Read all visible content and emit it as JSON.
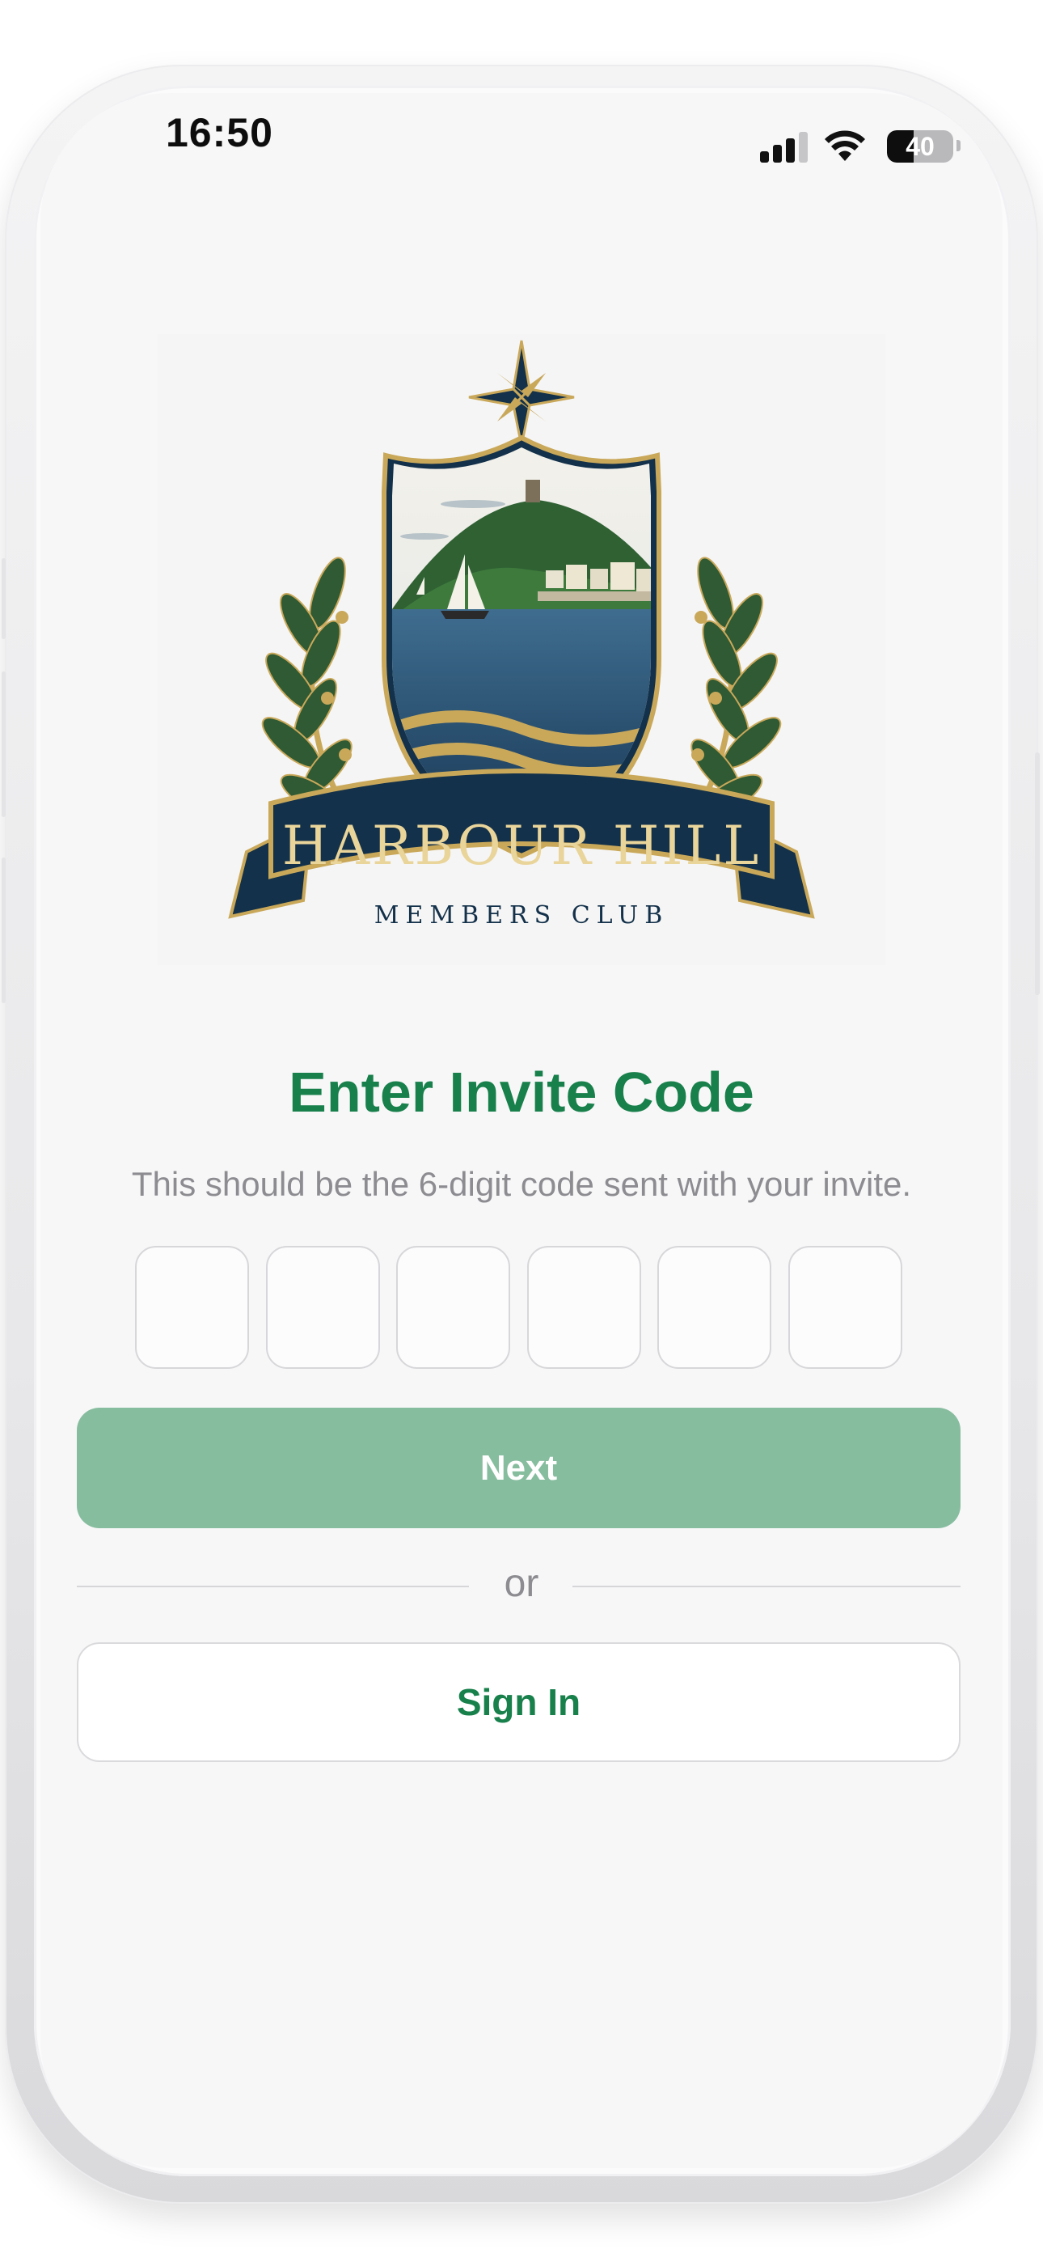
{
  "status_bar": {
    "time": "16:50",
    "battery_level": "40",
    "signal_bars_active": 3,
    "signal_bars_total": 4
  },
  "logo": {
    "title": "HARBOUR HILL",
    "subtitle": "MEMBERS CLUB"
  },
  "invite": {
    "heading": "Enter Invite Code",
    "instructions": "This should be the 6-digit code sent with your invite.",
    "code_digits": [
      "",
      "",
      "",
      "",
      "",
      ""
    ]
  },
  "actions": {
    "next_label": "Next",
    "separator_label": "or",
    "sign_in_label": "Sign In"
  },
  "colors": {
    "brand_green": "#18804b",
    "button_disabled_green": "#87bd9f",
    "navy": "#13314a",
    "gold": "#c9a85a",
    "foliage": "#2f5a33"
  }
}
